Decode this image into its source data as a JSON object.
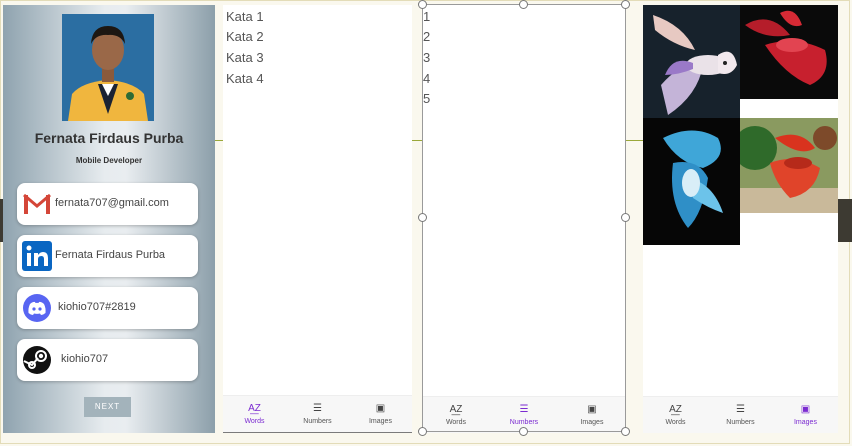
{
  "profile": {
    "name": "Fernata Firdaus Purba",
    "role": "Mobile Developer",
    "contacts": [
      {
        "icon": "gmail-icon",
        "text": "fernata707@gmail.com"
      },
      {
        "icon": "linkedin-icon",
        "text": "Fernata Firdaus Purba"
      },
      {
        "icon": "discord-icon",
        "text": "kiohio707#2819"
      },
      {
        "icon": "steam-icon",
        "text": "kiohio707"
      }
    ],
    "next_label": "NEXT"
  },
  "words_screen": {
    "items": [
      "Kata 1",
      "Kata 2",
      "Kata 3",
      "Kata 4"
    ],
    "active_tab": "Words"
  },
  "numbers_screen": {
    "items": [
      "1",
      "2",
      "3",
      "4",
      "5"
    ],
    "active_tab": "Numbers"
  },
  "images_screen": {
    "active_tab": "Images",
    "images": [
      "betta-fish-white",
      "betta-fish-red",
      "betta-fish-blue",
      "betta-fish-red-green"
    ]
  },
  "nav": {
    "words": "Words",
    "numbers": "Numbers",
    "images": "Images"
  },
  "colors": {
    "accent": "#7b2bd1"
  }
}
